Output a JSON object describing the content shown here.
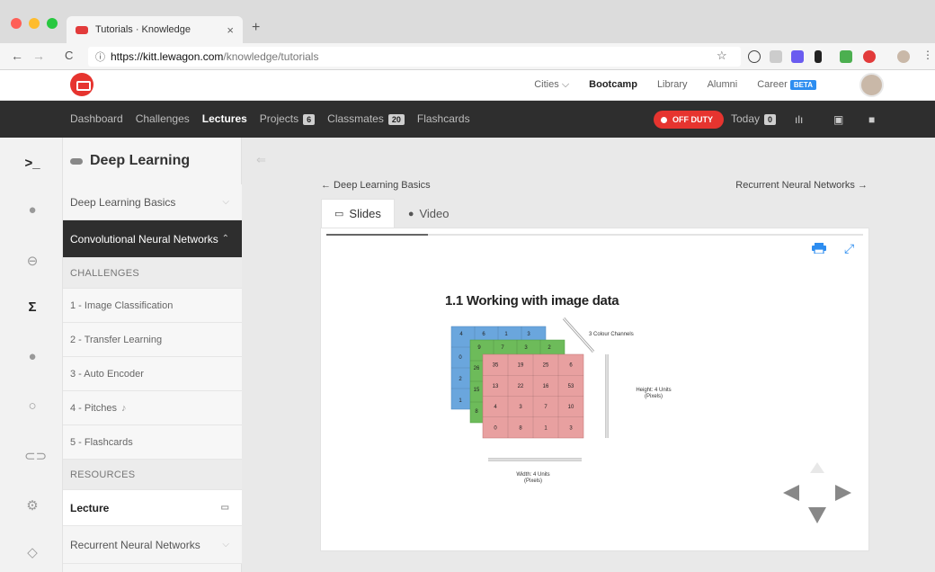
{
  "browser": {
    "tab_title": "Tutorials · Knowledge",
    "tab_close": "×",
    "new_tab": "+",
    "url_host": "https://kitt.lewagon.com",
    "url_path": "/knowledge/tutorials"
  },
  "header": {
    "nav": [
      "Cities",
      "Bootcamp",
      "Library",
      "Alumni",
      "Career"
    ],
    "cities_caret": "⌵",
    "beta": "BETA"
  },
  "subnav": {
    "items": [
      "Dashboard",
      "Challenges",
      "Lectures",
      "Projects",
      "Classmates",
      "Flashcards"
    ],
    "projects_count": "6",
    "classmates_count": "20",
    "status": "OFF DUTY",
    "today_label": "Today",
    "today_count": "0"
  },
  "sidebar": {
    "title": "Deep Learning",
    "basics": "Deep Learning Basics",
    "cnn": "Convolutional Neural Networks",
    "challenges_header": "CHALLENGES",
    "challenges": [
      "1 - Image Classification",
      "2 - Transfer Learning",
      "3 - Auto Encoder",
      "4 - Pitches",
      "5 - Flashcards"
    ],
    "resources_header": "RESOURCES",
    "lecture": "Lecture",
    "rnn": "Recurrent Neural Networks"
  },
  "main": {
    "prev": "← Deep Learning Basics",
    "next": "Recurrent Neural Networks →",
    "tab_slides": "Slides",
    "tab_video": "Video",
    "progress": 0.19
  },
  "slide": {
    "title": "1.1 Working with image data",
    "channels_label": "3 Colour Channels",
    "height_label_1": "Height: 4 Units",
    "height_label_2": "(Pixels)",
    "width_label_1": "Width: 4 Units",
    "width_label_2": "(Pixels)",
    "red_grid": [
      [
        "35",
        "19",
        "25",
        "6"
      ],
      [
        "13",
        "22",
        "16",
        "53"
      ],
      [
        "4",
        "3",
        "7",
        "10"
      ],
      [
        "0",
        "8",
        "1",
        "3"
      ]
    ],
    "green_top": [
      "9",
      "7",
      "3",
      "2"
    ],
    "green_left": [
      "26",
      "15",
      "8"
    ],
    "blue_top": [
      "4",
      "6",
      "1",
      "3"
    ],
    "blue_left": [
      "0",
      "2",
      "1"
    ]
  },
  "colors": {
    "red_channel": "#e8a0a0",
    "green_channel": "#6dbb5a",
    "blue_channel": "#6aa6dd",
    "accent": "#e6342f",
    "link_blue": "#2d8df0"
  }
}
